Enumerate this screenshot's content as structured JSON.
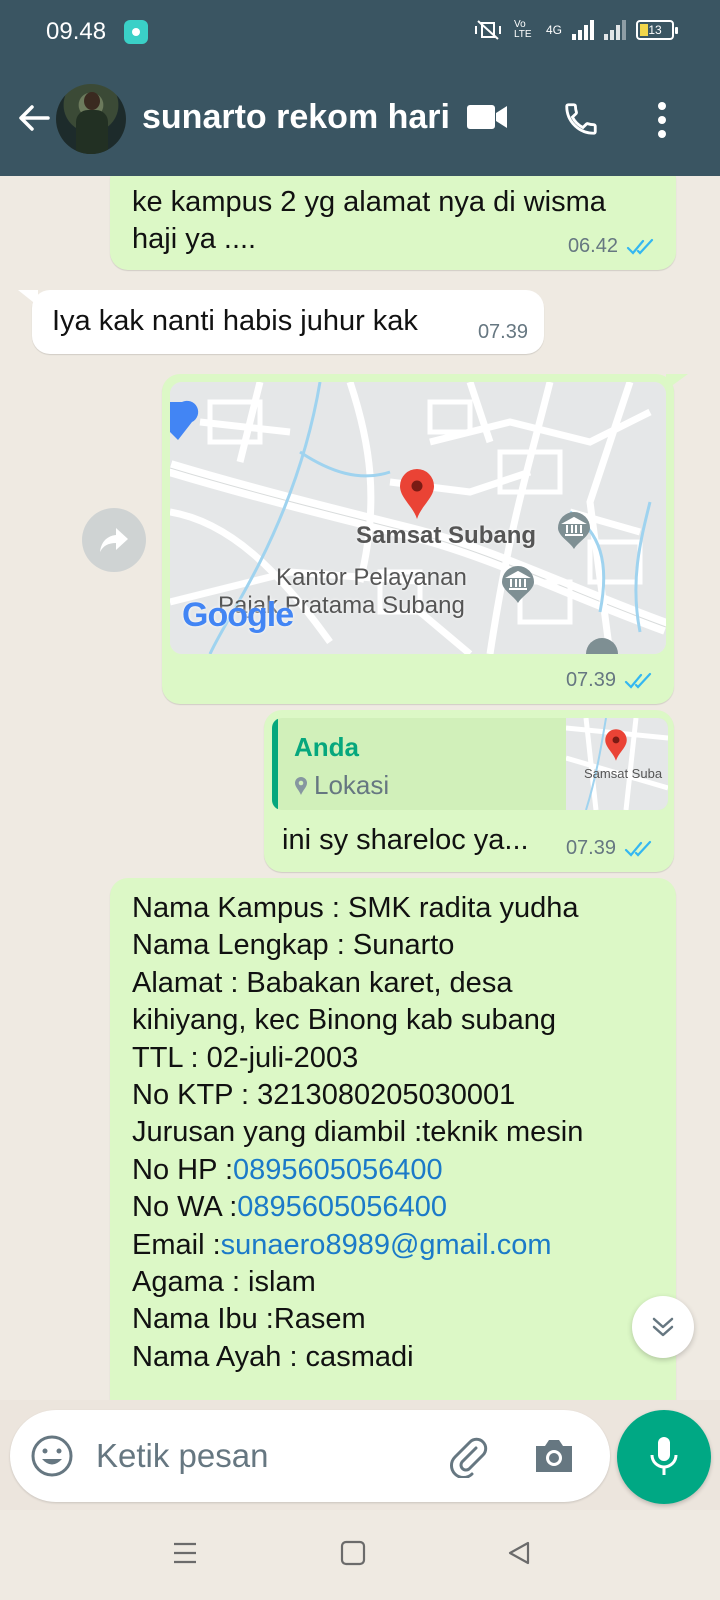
{
  "status_bar": {
    "time": "09.48",
    "network_label": "4G",
    "volte_label": "Vo LTE",
    "battery": "13"
  },
  "header": {
    "contact_name": "sunarto rekom hari"
  },
  "messages": [
    {
      "text": "ke kampus 2 yg alamat nya di wisma haji ya ....",
      "line1": "ke kampus 2 yg alamat nya di wisma",
      "line2": "haji ya ....",
      "time": "06.42"
    },
    {
      "text": "Iya kak nanti habis juhur kak",
      "time": "07.39"
    },
    {
      "type": "location",
      "time": "07.39",
      "place1": "Samsat Subang",
      "place2a": "Kantor Pelayanan",
      "place2b": "Pajak Pratama Subang",
      "provider": "Google"
    },
    {
      "reply_author": "Anda",
      "reply_type": "Lokasi",
      "thumb_place": "Samsat Suba",
      "text": "ini sy shareloc ya...",
      "time": "07.39"
    }
  ],
  "form_message": {
    "lines": [
      {
        "text": "Nama Kampus : SMK radita yudha"
      },
      {
        "text": "Nama Lengkap : Sunarto"
      },
      {
        "text": "Alamat : Babakan karet, desa"
      },
      {
        "text": "kihiyang, kec Binong kab subang"
      },
      {
        "text": "TTL : 02-juli-2003"
      },
      {
        "text": "No KTP : 3213080205030001"
      },
      {
        "text": "Jurusan yang diambil :teknik mesin"
      },
      {
        "label": "No HP :",
        "link": "0895605056400"
      },
      {
        "label": "No WA :",
        "link": "0895605056400"
      },
      {
        "label": "Email :",
        "link": "sunaero8989@gmail.com"
      },
      {
        "text": "Agama : islam"
      },
      {
        "text": "Nama Ibu :Rasem"
      },
      {
        "text": "Nama Ayah : casmadi"
      }
    ]
  },
  "input": {
    "placeholder": "Ketik pesan"
  },
  "colors": {
    "header": "#3a5562",
    "outgoing": "#dcf8c6",
    "incoming": "#ffffff",
    "accent": "#00a884",
    "tick": "#34b7f1"
  },
  "icons": [
    "back-arrow-icon",
    "video-call-icon",
    "phone-icon",
    "more-vert-icon",
    "forward-icon",
    "emoji-icon",
    "attach-icon",
    "camera-icon",
    "mic-icon",
    "chevron-double-down-icon"
  ]
}
